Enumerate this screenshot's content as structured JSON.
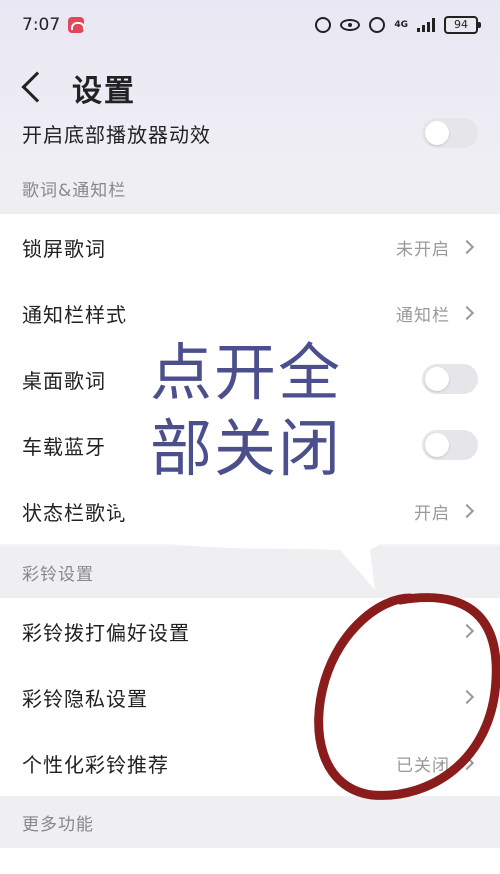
{
  "status_bar": {
    "time": "7:07",
    "network": "4G",
    "battery": "94"
  },
  "header": {
    "title": "设置"
  },
  "rows": {
    "bottom_player_anim": "开启底部播放器动效",
    "lock_lyrics": {
      "label": "锁屏歌词",
      "value": "未开启"
    },
    "notif_style": {
      "label": "通知栏样式",
      "value": "通知栏"
    },
    "desktop_lyrics": {
      "label": "桌面歌词"
    },
    "car_bluetooth": {
      "label": "车载蓝牙"
    },
    "statusbar_lyrics": {
      "label": "状态栏歌词",
      "value": "开启"
    },
    "ring_pref": {
      "label": "彩铃拨打偏好设置"
    },
    "ring_privacy": {
      "label": "彩铃隐私设置"
    },
    "ring_recommend": {
      "label": "个性化彩铃推荐",
      "value": "已关闭"
    },
    "bottom_partial": {
      "label": ""
    }
  },
  "sections": {
    "lyrics_notif": "歌词&通知栏",
    "ringtone": "彩铃设置",
    "more": "更多功能"
  },
  "annotation": {
    "text": "点开全部关闭",
    "line1": "点开全",
    "line2": "部关闭",
    "circle_color": "#8b1c1c",
    "text_color": "#4b4f8c"
  },
  "colors": {
    "accent": "#e2465b"
  }
}
